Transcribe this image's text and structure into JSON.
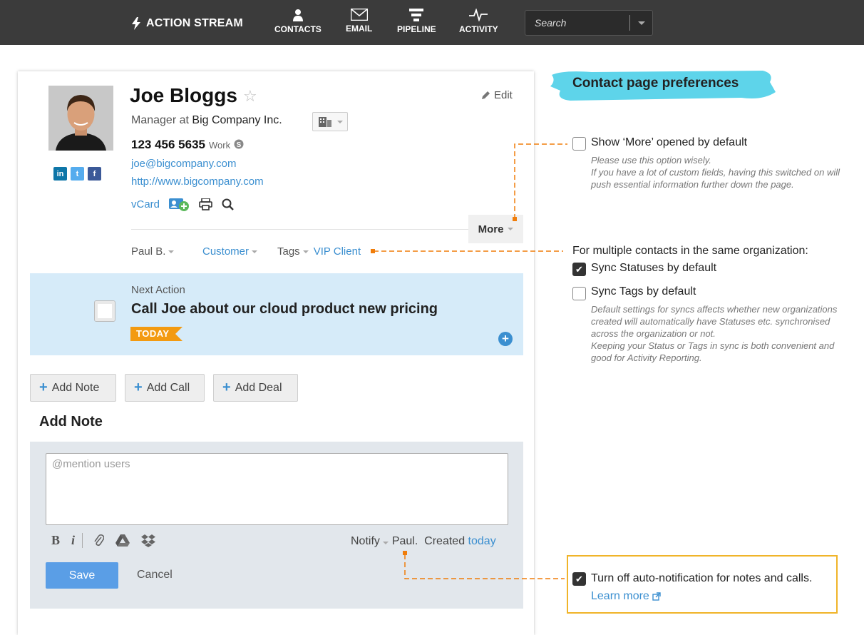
{
  "topbar": {
    "brand": "ACTION STREAM",
    "nav": [
      {
        "label": "CONTACTS",
        "icon": "person-icon"
      },
      {
        "label": "EMAIL",
        "icon": "envelope-icon"
      },
      {
        "label": "PIPELINE",
        "icon": "funnel-icon"
      },
      {
        "label": "ACTIVITY",
        "icon": "pulse-icon"
      }
    ],
    "search_placeholder": "Search"
  },
  "contact": {
    "name": "Joe Bloggs",
    "job_prefix": "Manager at",
    "company": "Big Company Inc.",
    "edit_label": "Edit",
    "phone": "123 456 5635",
    "phone_type": "Work",
    "email": "joe@bigcompany.com",
    "website": "http://www.bigcompany.com",
    "vcard": "vCard",
    "more_label": "More",
    "owner": "Paul B.",
    "status": "Customer",
    "tags_label": "Tags",
    "tag": "VIP Client"
  },
  "next_action": {
    "heading": "Next Action",
    "title": "Call Joe about our cloud product new pricing",
    "badge": "TODAY"
  },
  "actions": {
    "add_note": "Add Note",
    "add_call": "Add Call",
    "add_deal": "Add Deal"
  },
  "note_form": {
    "heading": "Add Note",
    "placeholder": "@mention users",
    "notify_label": "Notify",
    "notify_user": "Paul.",
    "created_label": "Created",
    "created_value": "today",
    "save": "Save",
    "cancel": "Cancel"
  },
  "preferences": {
    "title": "Contact page preferences",
    "show_more": {
      "label": "Show ‘More’ opened by default",
      "checked": false,
      "note1": "Please use this option wisely.",
      "note2": "If you have a lot of custom fields, having this switched on will push essential information further down the page."
    },
    "multi_heading": "For multiple contacts in the same organization:",
    "sync_statuses": {
      "label": "Sync Statuses by default",
      "checked": true
    },
    "sync_tags": {
      "label": "Sync Tags by default",
      "checked": false,
      "note1": "Default settings for syncs affects whether new organizations created will automatically have Statuses etc. synchronised across the organization or not.",
      "note2": "Keeping your Status or Tags in sync is both convenient and good for Activity Reporting."
    },
    "auto_notify": {
      "label": "Turn off auto-notification for notes and calls.",
      "checked": true,
      "learn_more": "Learn more"
    }
  },
  "colors": {
    "accent": "#3b8fd0",
    "callout": "#f07d0a",
    "highlight": "#f0b429",
    "banner": "#5ed4ea"
  }
}
